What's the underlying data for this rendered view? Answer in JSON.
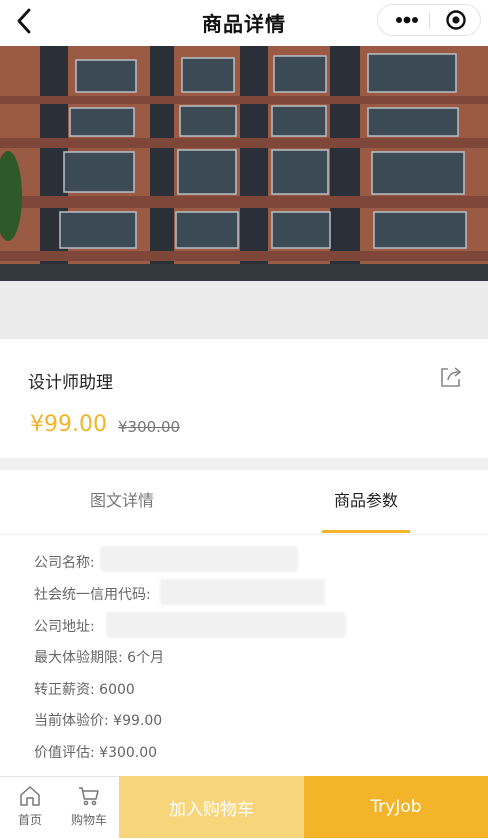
{
  "header": {
    "title": "商品详情",
    "back_icon": "chevron-left-icon",
    "more_icon": "more-dots-icon",
    "close_icon": "target-close-icon"
  },
  "banner": {
    "image": "building-facade-photo",
    "dots_count": 5,
    "active_dot": 4
  },
  "product": {
    "name": "设计师助理",
    "price": "¥99.00",
    "original_price": "¥300.00",
    "share_icon": "share-icon",
    "accent_color": "#f3b42a"
  },
  "tabs": [
    {
      "label": "图文详情",
      "active": false
    },
    {
      "label": "商品参数",
      "active": true
    }
  ],
  "params": [
    {
      "label": "公司名称:",
      "value": ""
    },
    {
      "label": "社会统一信用代码:",
      "value": ""
    },
    {
      "label": "公司地址:",
      "value": ""
    },
    {
      "label": "最大体验期限:",
      "value": "6个月"
    },
    {
      "label": "转正薪资:",
      "value": "6000"
    },
    {
      "label": "当前体验价:",
      "value": "¥99.00"
    },
    {
      "label": "价值评估:",
      "value": "¥300.00"
    }
  ],
  "bottom": {
    "home_label": "首页",
    "cart_label": "购物车",
    "add_to_cart": "加入购物车",
    "try_job": "TryJob"
  }
}
